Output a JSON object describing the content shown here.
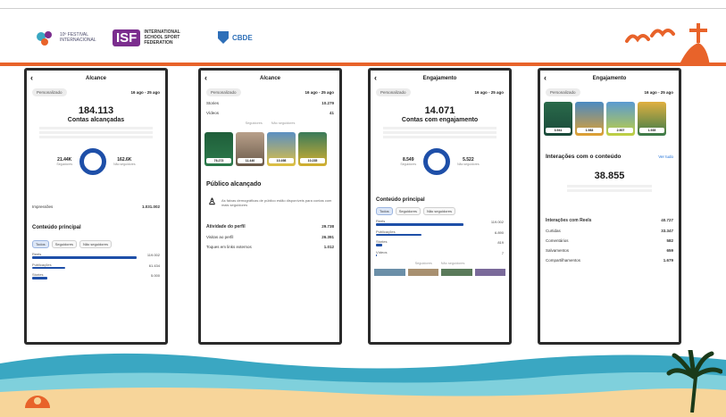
{
  "header": {
    "logo1_lines": [
      "10º FESTIVAL",
      "INTERNACIONAL"
    ],
    "isf_label": "ISF",
    "isf_lines": [
      "INTERNATIONAL",
      "SCHOOL SPORT",
      "FEDERATION"
    ],
    "cbde_label": "CBDE"
  },
  "phones": [
    {
      "title": "Alcance",
      "filter": "Personalizado",
      "date_range": "16 ago - 25 ago",
      "big_number": "184.113",
      "big_label": "Contas alcançadas",
      "left_stat": {
        "value": "21.44K",
        "label": "Seguidores"
      },
      "right_stat": {
        "value": "162.6K",
        "label": "Não seguidores"
      },
      "impressions": {
        "label": "Impressões",
        "value": "1.031.002"
      },
      "section": "Conteúdo principal",
      "tabs": [
        "Todos",
        "Seguidores",
        "Não seguidores"
      ],
      "bars": [
        {
          "label": "Reels",
          "value": "119.002",
          "pct": 0.95
        },
        {
          "label": "Publicações",
          "value": "61.434",
          "pct": 0.3
        },
        {
          "label": "Stories",
          "value": "5.000",
          "pct": 0.13
        }
      ]
    },
    {
      "title": "Alcance",
      "filter": "Personalizado",
      "date_range": "16 ago - 25 ago",
      "top_rows": [
        {
          "label": "Stories",
          "value": "10.279"
        },
        {
          "label": "Vídeos",
          "value": "41"
        }
      ],
      "legend": [
        "Seguidores",
        "Não seguidores"
      ],
      "thumbs": [
        "76.273",
        "11.440",
        "10.498",
        "10.235"
      ],
      "section": "Público alcançado",
      "info": "As faixas demográficas de público estão disponíveis para contas com mais seguidores",
      "kv": [
        {
          "label": "Atividade do perfil",
          "value": "29.738"
        },
        {
          "label": "Visitas ao perfil",
          "value": "26.391"
        },
        {
          "label": "Toques em links externos",
          "value": "1.012"
        }
      ]
    },
    {
      "title": "Engajamento",
      "filter": "Personalizado",
      "date_range": "16 ago - 25 ago",
      "big_number": "14.071",
      "big_label": "Contas com engajamento",
      "left_stat": {
        "value": "8.549",
        "label": "Seguidores"
      },
      "right_stat": {
        "value": "5.522",
        "label": "Não seguidores"
      },
      "section": "Conteúdo principal",
      "tabs": [
        "Todos",
        "Seguidores",
        "Não seguidores"
      ],
      "bars": [
        {
          "label": "Reels",
          "value": "119.002",
          "pct": 0.8
        },
        {
          "label": "Publicações",
          "value": "6.890",
          "pct": 0.4
        },
        {
          "label": "Stories",
          "value": "819",
          "pct": 0.05
        },
        {
          "label": "Vídeos",
          "value": "7",
          "pct": 0.01
        }
      ],
      "legend": [
        "Seguidores",
        "Não seguidores"
      ]
    },
    {
      "title": "Engajamento",
      "filter": "Personalizado",
      "date_range": "16 ago - 25 ago",
      "thumbs": [
        "3.941",
        "1.983",
        "2.907",
        "1.935"
      ],
      "section": "Interações com o conteúdo",
      "see_all": "Ver tudo",
      "big_number": "38.855",
      "kv": [
        {
          "label": "Interações com Reels",
          "value": "40.727"
        },
        {
          "label": "Curtidas",
          "value": "33.347"
        },
        {
          "label": "Comentários",
          "value": "582"
        },
        {
          "label": "Salvamentos",
          "value": "659"
        },
        {
          "label": "Compartilhamentos",
          "value": "1.679"
        }
      ]
    }
  ],
  "colors": {
    "accent_orange": "#e8632a",
    "isf_purple": "#7b2d8e",
    "ig_blue": "#1e4fa8",
    "sea": "#3aa7c2",
    "sand": "#f7d59a"
  }
}
